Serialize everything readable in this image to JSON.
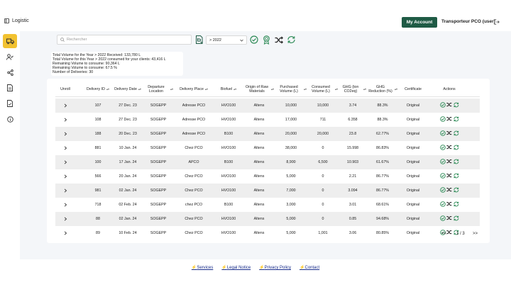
{
  "header": {
    "app_title": "Logistic",
    "account_button": "My Account",
    "user": "Transporteur PCO (user)"
  },
  "toolbar": {
    "search_placeholder": "Rechercher",
    "year_filter": "> 2022"
  },
  "summary": [
    "Total Volume for the Year > 2022 Received: 133,780 L",
    "Total Volume for this Year > 2022 consumed for your clients: 43,416 L",
    "Remaining Volume to consume: 90,364 L",
    "Remaining Volume to consume: 67.5 %",
    "Number of Deliveries: 30"
  ],
  "table": {
    "columns": [
      {
        "label": "Unroll",
        "sortable": false
      },
      {
        "label": "Delivery ID",
        "sortable": true
      },
      {
        "label": "Delivery Date",
        "sortable": true
      },
      {
        "label": "Departure Location",
        "sortable": true
      },
      {
        "label": "Delivery Place",
        "sortable": true
      },
      {
        "label": "Biofuel",
        "sortable": true
      },
      {
        "label": "Origin of Raw Materials",
        "sortable": true
      },
      {
        "label": "Purchased Volume (L)",
        "sortable": true
      },
      {
        "label": "Consumed Volume (L)",
        "sortable": true
      },
      {
        "label": "GHG (ton CO2eq)",
        "sortable": true
      },
      {
        "label": "GHG Reduction (%)",
        "sortable": true
      },
      {
        "label": "Certificate",
        "sortable": false
      },
      {
        "label": "Actions",
        "sortable": false
      }
    ],
    "rows": [
      [
        "107",
        "27 Dec. 23",
        "SOGEPP",
        "Adresse PCO",
        "HVO100",
        "Altens",
        "10,000",
        "10,000",
        "3.74",
        "88.3%",
        "Original"
      ],
      [
        "108",
        "27 Dec. 23",
        "SOGEPP",
        "Adresse PCO",
        "HVO100",
        "Altens",
        "17,000",
        "711",
        "6.358",
        "88.3%",
        "Original"
      ],
      [
        "188",
        "20 Dec. 23",
        "SOGEPP",
        "Adresse PCO",
        "B100",
        "Altens",
        "20,000",
        "20,000",
        "23.8",
        "62.77%",
        "Original"
      ],
      [
        "881",
        "10 Jan. 24",
        "SOGEPP",
        "Chez PCO",
        "HVO100",
        "Altens",
        "38,000",
        "0",
        "15.998",
        "86.83%",
        "Original"
      ],
      [
        "100",
        "17 Jan. 24",
        "SOGEPP",
        "APCO",
        "B100",
        "Altens",
        "8,900",
        "6,500",
        "10.903",
        "61.67%",
        "Original"
      ],
      [
        "566",
        "20 Jan. 24",
        "SOGEPP",
        "Chez PCO",
        "HVO100",
        "Altens",
        "5,000",
        "0",
        "2.21",
        "86.77%",
        "Original"
      ],
      [
        "981",
        "02 Jan. 24",
        "SOGEPP",
        "Chez PCO",
        "HVO100",
        "Altens",
        "7,000",
        "0",
        "3.094",
        "86.77%",
        "Original"
      ],
      [
        "718",
        "02 Feb. 24",
        "SOGEPP",
        "chez PCO",
        "B100",
        "Altens",
        "3,000",
        "0",
        "3.01",
        "68.61%",
        "Original"
      ],
      [
        "88",
        "02 Jan. 24",
        "SOGEPP",
        "Chez PCO",
        "HVO100",
        "Altens",
        "5,000",
        "0",
        "0.85",
        "94.68%",
        "Original"
      ],
      [
        "89",
        "10 Feb. 24",
        "SOGEPP",
        "Chez PCO",
        "HVO100",
        "Altens",
        "5,000",
        "1,001",
        "3.06",
        "80.85%",
        "Original"
      ]
    ]
  },
  "pagination": {
    "prev": "<<",
    "page": "1 / 3",
    "next": ">>"
  },
  "footer": {
    "links": [
      "Services",
      "Legal Notice",
      "Privacy Policy",
      "Contact"
    ]
  },
  "colors": {
    "accent_green": "#1f5b45",
    "icon_green": "#2e8b57",
    "active_yellow": "#f2c230"
  },
  "icons": {
    "sidebar": [
      "truck-icon",
      "user-check-icon",
      "share-icon",
      "document-icon",
      "document-check-icon",
      "info-icon"
    ],
    "toolbar": [
      "search-icon",
      "export-file-icon",
      "check-circle-icon",
      "certificate-icon",
      "shuffle-icon",
      "refresh-icon"
    ]
  }
}
